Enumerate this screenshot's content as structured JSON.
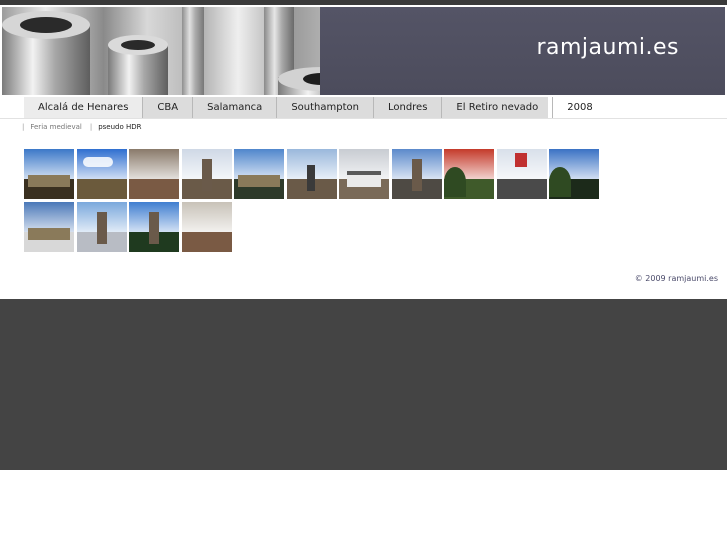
{
  "header": {
    "brand": "ramjaumi.es",
    "photo": "metal-cylinders-photo"
  },
  "nav": {
    "items": [
      {
        "label": "Alcalá de Henares",
        "active": true
      },
      {
        "label": "CBA",
        "active": false
      },
      {
        "label": "Salamanca",
        "active": false
      },
      {
        "label": "Southampton",
        "active": false
      },
      {
        "label": "Londres",
        "active": false
      },
      {
        "label": "El Retiro nevado",
        "active": false
      },
      {
        "label": "2008",
        "active": false
      }
    ]
  },
  "subnav": {
    "items": [
      {
        "label": "Feria medieval",
        "current": false
      },
      {
        "label": "pseudo HDR",
        "current": true
      }
    ]
  },
  "thumbnails": [
    {
      "name": "thumb-1",
      "sky": "#3b78c8",
      "ground": "#3a3020",
      "subject": "building"
    },
    {
      "name": "thumb-2",
      "sky": "#2f6fd0",
      "ground": "#6b5a3c",
      "subject": "clouds"
    },
    {
      "name": "thumb-3",
      "sky": "#8a7a6a",
      "ground": "#5a4030",
      "subject": "crowd"
    },
    {
      "name": "thumb-4",
      "sky": "#cfd8e6",
      "ground": "#6a5a48",
      "subject": "tower"
    },
    {
      "name": "thumb-5",
      "sky": "#4f86cc",
      "ground": "#2e3a2a",
      "subject": "building"
    },
    {
      "name": "thumb-6",
      "sky": "#9ab8dc",
      "ground": "#6a5a48",
      "subject": "statue"
    },
    {
      "name": "thumb-7",
      "sky": "#c8ccd2",
      "ground": "#7a6a58",
      "subject": "kiosk"
    },
    {
      "name": "thumb-8",
      "sky": "#5b8acb",
      "ground": "#4e4a44",
      "subject": "tower"
    },
    {
      "name": "thumb-9",
      "sky": "#c43a2a",
      "ground": "#3f5a2a",
      "subject": "trees"
    },
    {
      "name": "thumb-10",
      "sky": "#d8e0ea",
      "ground": "#4a4a4a",
      "subject": "sign"
    },
    {
      "name": "thumb-11",
      "sky": "#3a72c4",
      "ground": "#1c2a1a",
      "subject": "trees"
    },
    {
      "name": "thumb-12",
      "sky": "#4a78b8",
      "ground": "#d8d8d8",
      "subject": "building"
    },
    {
      "name": "thumb-13",
      "sky": "#7aa8dc",
      "ground": "#b8bcc4",
      "subject": "tower"
    },
    {
      "name": "thumb-14",
      "sky": "#3f7ed0",
      "ground": "#1f3a1f",
      "subject": "tower"
    },
    {
      "name": "thumb-15",
      "sky": "#c8c2b8",
      "ground": "#a06a4a",
      "subject": "street"
    }
  ],
  "footer": {
    "copyright": "© 2009 ramjaumi.es"
  }
}
